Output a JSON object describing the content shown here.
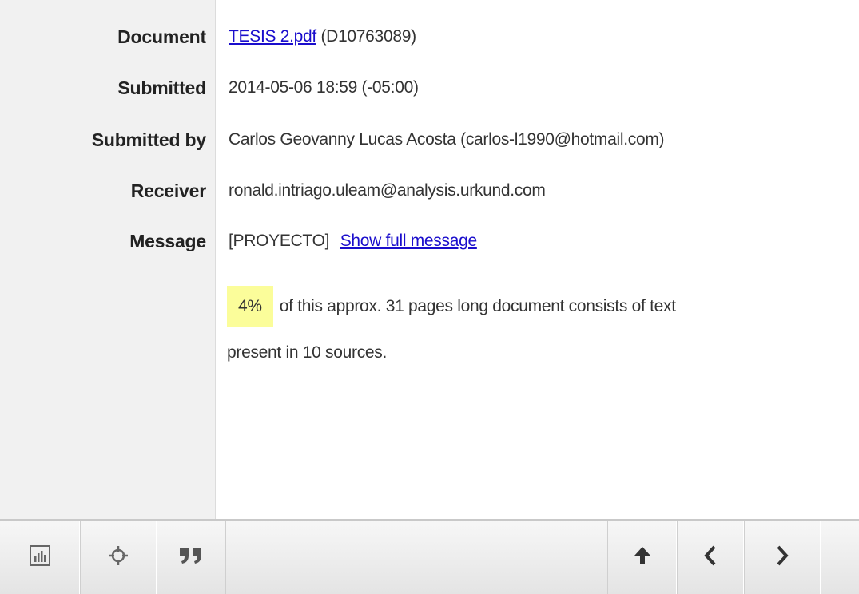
{
  "details": {
    "document_label": "Document",
    "document_link": "TESIS 2.pdf",
    "document_id": "(D10763089)",
    "submitted_label": "Submitted",
    "submitted_value": "2014-05-06 18:59 (-05:00)",
    "submitted_by_label": "Submitted by",
    "submitted_by_value": "Carlos Geovanny Lucas Acosta (carlos-l1990@hotmail.com)",
    "receiver_label": "Receiver",
    "receiver_value": "ronald.intriago.uleam@analysis.urkund.com",
    "message_label": "Message",
    "message_value": "[PROYECTO]",
    "message_link": "Show full message"
  },
  "summary": {
    "percentage": "4%",
    "text_line1": "of this approx. 31 pages long document consists of text",
    "text_line2": "present in 10 sources."
  },
  "toolbar": {
    "icons": [
      "bar-chart-icon",
      "crosshair-icon",
      "quote-icon",
      "arrow-up-icon",
      "chevron-left-icon",
      "chevron-right-icon"
    ]
  },
  "colors": {
    "link": "#1a0dcc",
    "highlight": "#fbfd9a",
    "label_column": "#f1f1f1"
  }
}
